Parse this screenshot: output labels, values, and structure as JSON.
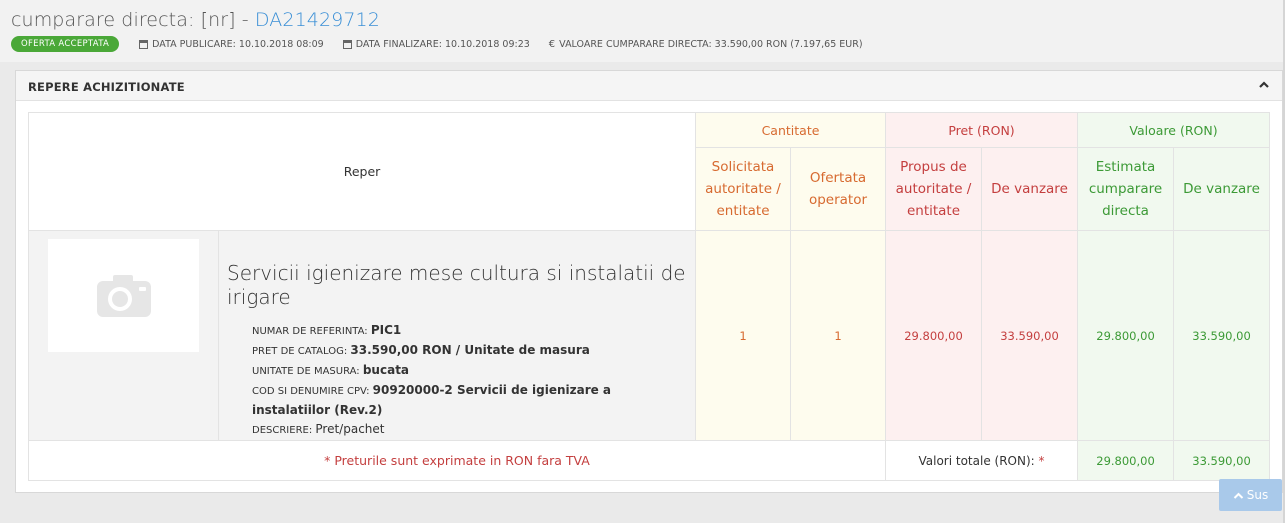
{
  "header": {
    "title_prefix": "cumparare directa: [nr] - ",
    "title_code": "DA21429712",
    "status_badge": "OFERTA ACCEPTATA",
    "data_publicare": "DATA PUBLICARE: 10.10.2018 08:09",
    "data_finalizare": "DATA FINALIZARE: 10.10.2018 09:23",
    "valoare": "VALOARE CUMPARARE DIRECTA: 33.590,00  RON (7.197,65  EUR)",
    "calendar_icon": "calendar-icon",
    "euro_icon": "€"
  },
  "panel": {
    "title": "REPERE ACHIZITIONATE",
    "collapse_icon": "chevron-up-icon"
  },
  "table": {
    "reper_header": "Reper",
    "group_cantitate": "Cantitate",
    "group_pret": "Pret (RON)",
    "group_valoare": "Valoare (RON)",
    "sub_solicitata": "Solicitata autoritate / entitate",
    "sub_ofertata": "Ofertata operator",
    "sub_propus": "Propus de autoritate / entitate",
    "sub_pret_vanzare": "De vanzare",
    "sub_estimata": "Estimata cumparare directa",
    "sub_val_vanzare": "De vanzare",
    "item": {
      "name": "Servicii igienizare mese cultura si instalatii de irigare",
      "ref_label": "NUMAR DE REFERINTA: ",
      "ref_value": "PIC1",
      "catalog_label": "PRET DE CATALOG: ",
      "catalog_value": "33.590,00  RON / Unitate de masura",
      "unit_label": "UNITATE DE MASURA: ",
      "unit_value": "bucata",
      "cpv_label": "COD SI DENUMIRE CPV: ",
      "cpv_value": "90920000-2 Servicii de igienizare a instalatiilor (Rev.2)",
      "desc_label": "DESCRIERE: ",
      "desc_value": "Pret/pachet",
      "image_icon": "camera-icon",
      "solicitata": "1",
      "ofertata": "1",
      "propus": "29.800,00",
      "pret_vanzare": "33.590,00",
      "estimata": "29.800,00",
      "val_vanzare": "33.590,00"
    },
    "footer_note": "* Preturile sunt exprimate in RON fara TVA",
    "totals_label": "Valori totale (RON): ",
    "totals_star": "*",
    "total_estimata": "29.800,00",
    "total_vanzare": "33.590,00"
  },
  "scroll_top": {
    "label": "Sus",
    "icon": "chevron-up-icon"
  },
  "colors": {
    "accent_blue": "#3a8fd6",
    "badge_green": "#4aa838",
    "cantitate": "#d76a30",
    "pret": "#c43f3f",
    "valoare": "#3c9a36"
  }
}
